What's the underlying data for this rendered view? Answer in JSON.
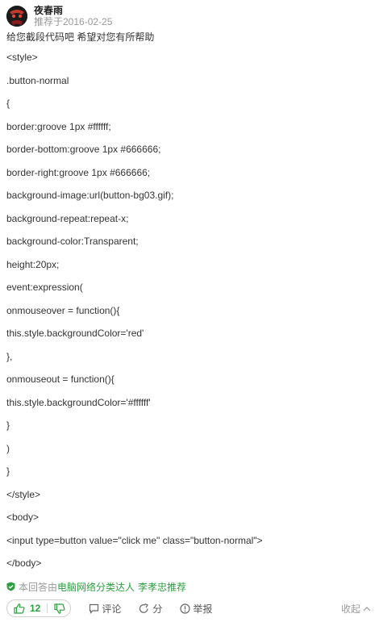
{
  "author": {
    "name": "夜春雨",
    "recommend_time": "推荐于2016-02-25"
  },
  "answer": {
    "lines": [
      "给您截段代码吧 希望对您有所帮助",
      "<style>",
      ".button-normal",
      "{",
      "border:groove 1px #ffffff;",
      "border-bottom:groove 1px #666666;",
      "border-right:groove 1px #666666;",
      "background-image:url(button-bg03.gif);",
      "background-repeat:repeat-x;",
      "background-color:Transparent;",
      "height:20px;",
      "event:expression(",
      "onmouseover = function(){",
      "this.style.backgroundColor='red'",
      "},",
      "onmouseout = function(){",
      "this.style.backgroundColor='#ffffff'",
      "}",
      ")",
      "}",
      "</style>",
      "<body>",
      "<input type=button value=\"click me\" class=\"button-normal\">",
      "</body>"
    ]
  },
  "recommendation": {
    "prefix": "本回答由",
    "category": "电脑网络分类达人",
    "person": "李孝忠",
    "suffix": "推荐"
  },
  "actions": {
    "upvote_count": "12",
    "comment_label": "评论",
    "share_label": "分",
    "report_label": "举报",
    "collapse_label": "收起"
  },
  "colors": {
    "accent_green": "#2c9e3f",
    "muted_text": "#999999",
    "body_text": "#333333"
  },
  "icons": [
    "avatar-image",
    "shield-check-icon",
    "thumbs-up-icon",
    "thumbs-down-icon",
    "comment-icon",
    "share-icon",
    "report-icon",
    "chevron-up-icon"
  ]
}
